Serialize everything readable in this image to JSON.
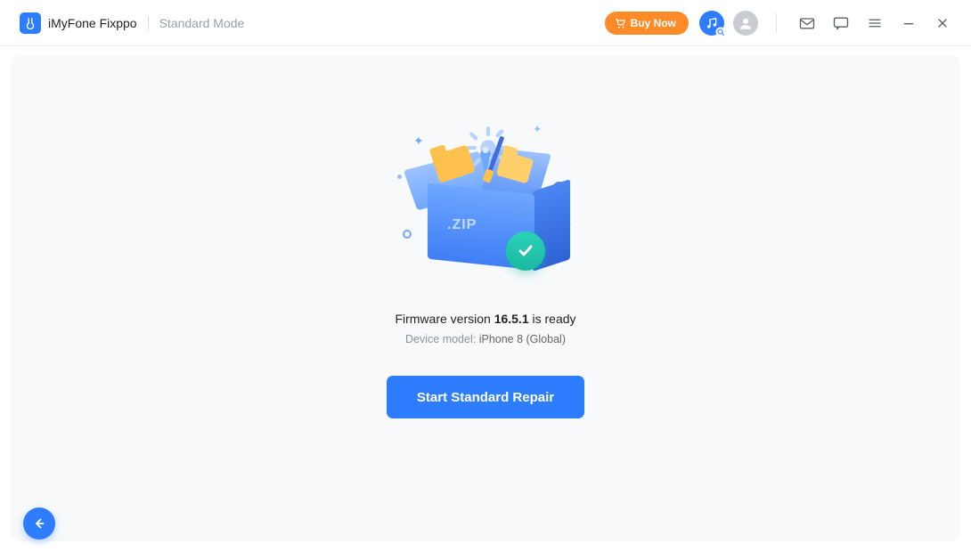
{
  "header": {
    "app_name": "iMyFone Fixppo",
    "mode_label": "Standard Mode",
    "buy_label": "Buy Now"
  },
  "main": {
    "zip_label": ".ZIP",
    "firmware_prefix": "Firmware version ",
    "firmware_version": "16.5.1",
    "firmware_suffix": " is ready",
    "device_label": "Device model: ",
    "device_value": "iPhone 8 (Global)",
    "action_label": "Start Standard Repair"
  },
  "colors": {
    "accent": "#2e7dff",
    "buy": "#ff8a28",
    "success": "#1ab89f"
  }
}
